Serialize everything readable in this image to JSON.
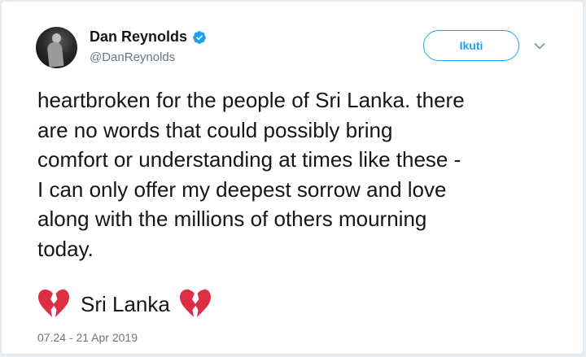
{
  "tweet": {
    "author": {
      "display_name": "Dan Reynolds",
      "handle": "@DanReynolds",
      "verified": true,
      "avatar_icon": "profile-photo"
    },
    "follow_label": "Ikuti",
    "menu_icon": "chevron-down-icon",
    "text": "heartbroken for the people of Sri Lanka. there\nare no words that could possibly bring\ncomfort or understanding at times like these -\nI can only offer my deepest sorrow and love\nalong with the millions of others mourning\ntoday.",
    "footer_line": {
      "emoji_left": "broken-heart-icon",
      "text": "Sri Lanka",
      "emoji_right": "broken-heart-icon"
    },
    "timestamp": "07.24 - 21 Apr 2019"
  },
  "colors": {
    "accent": "#1da1f2",
    "text": "#14171a",
    "secondary": "#657786",
    "heart": "#e0245e"
  }
}
